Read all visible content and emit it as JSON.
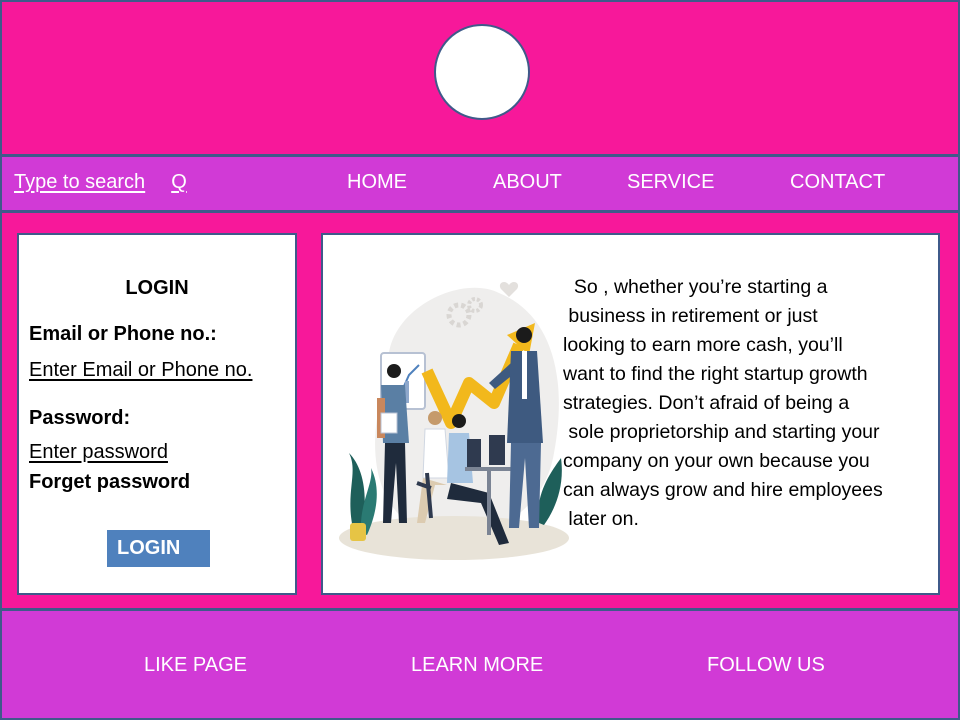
{
  "nav": {
    "search_label": "Type to search",
    "search_icon_text": "Q",
    "items": [
      "HOME",
      "ABOUT",
      "SERVICE",
      "CONTACT"
    ]
  },
  "login": {
    "title": "LOGIN",
    "email_label": "Email or Phone no.:",
    "email_placeholder": "Enter Email or Phone no.",
    "password_label": "Password:",
    "password_placeholder": "Enter password",
    "forget_link": "Forget password",
    "button_label": "LOGIN"
  },
  "content": {
    "paragraph_lines": [
      "  So , whether you’re starting a",
      " business in retirement or just",
      "looking to earn more cash, you’ll",
      "want to find the right startup growth",
      "strategies. Don’t afraid of being a",
      " sole proprietorship and starting your",
      "company on your own because you",
      "can always grow and hire employees",
      " later on."
    ]
  },
  "footer": {
    "links": [
      "LIKE PAGE",
      "LEARN MORE",
      "FOLLOW US"
    ]
  },
  "colors": {
    "header_bg": "#f7189a",
    "nav_bg": "#d13ad6",
    "border": "#3f5a8a",
    "button_bg": "#4f81bd"
  }
}
